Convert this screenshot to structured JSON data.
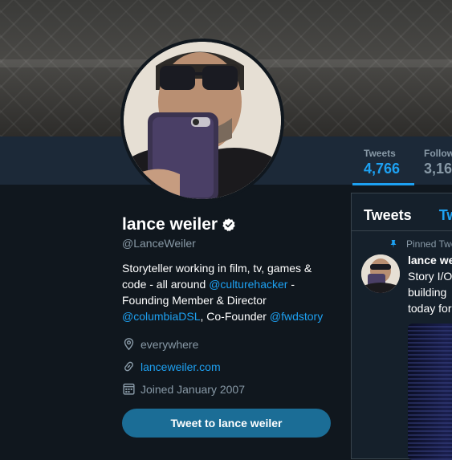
{
  "profile": {
    "name": "lance weiler",
    "handle": "@LanceWeiler",
    "bio": {
      "part1": "Storyteller working in film, tv, games & code - all around ",
      "mention1": "@culturehacker",
      "part2": " - Founding Member & Director ",
      "mention2": "@columbiaDSL",
      "part3": ", Co-Founder ",
      "mention3": "@fwdstory"
    },
    "location": "everywhere",
    "website": "lanceweiler.com",
    "joined": "Joined January 2007",
    "tweet_button": "Tweet to lance weiler"
  },
  "stats": {
    "tweets_label": "Tweets",
    "tweets_value": "4,766",
    "following_label": "Follow",
    "following_value": "3,16"
  },
  "timeline": {
    "tab_tweets": "Tweets",
    "tab_replies": "Tw",
    "pinned_label": "Pinned Twe",
    "tweet_name": "lance we",
    "tweet_line1": "Story I/O",
    "tweet_line2": "building",
    "tweet_line3": "today for"
  },
  "icons": {
    "location": "map-pin-icon",
    "website": "link-icon",
    "joined": "calendar-icon",
    "verified": "verified-badge-icon",
    "pinned": "pin-icon"
  },
  "colors": {
    "accent": "#1da1f2",
    "background": "#10171e",
    "navbar": "#1c2938",
    "button": "#1b6d96",
    "muted_text": "#8899a6"
  }
}
